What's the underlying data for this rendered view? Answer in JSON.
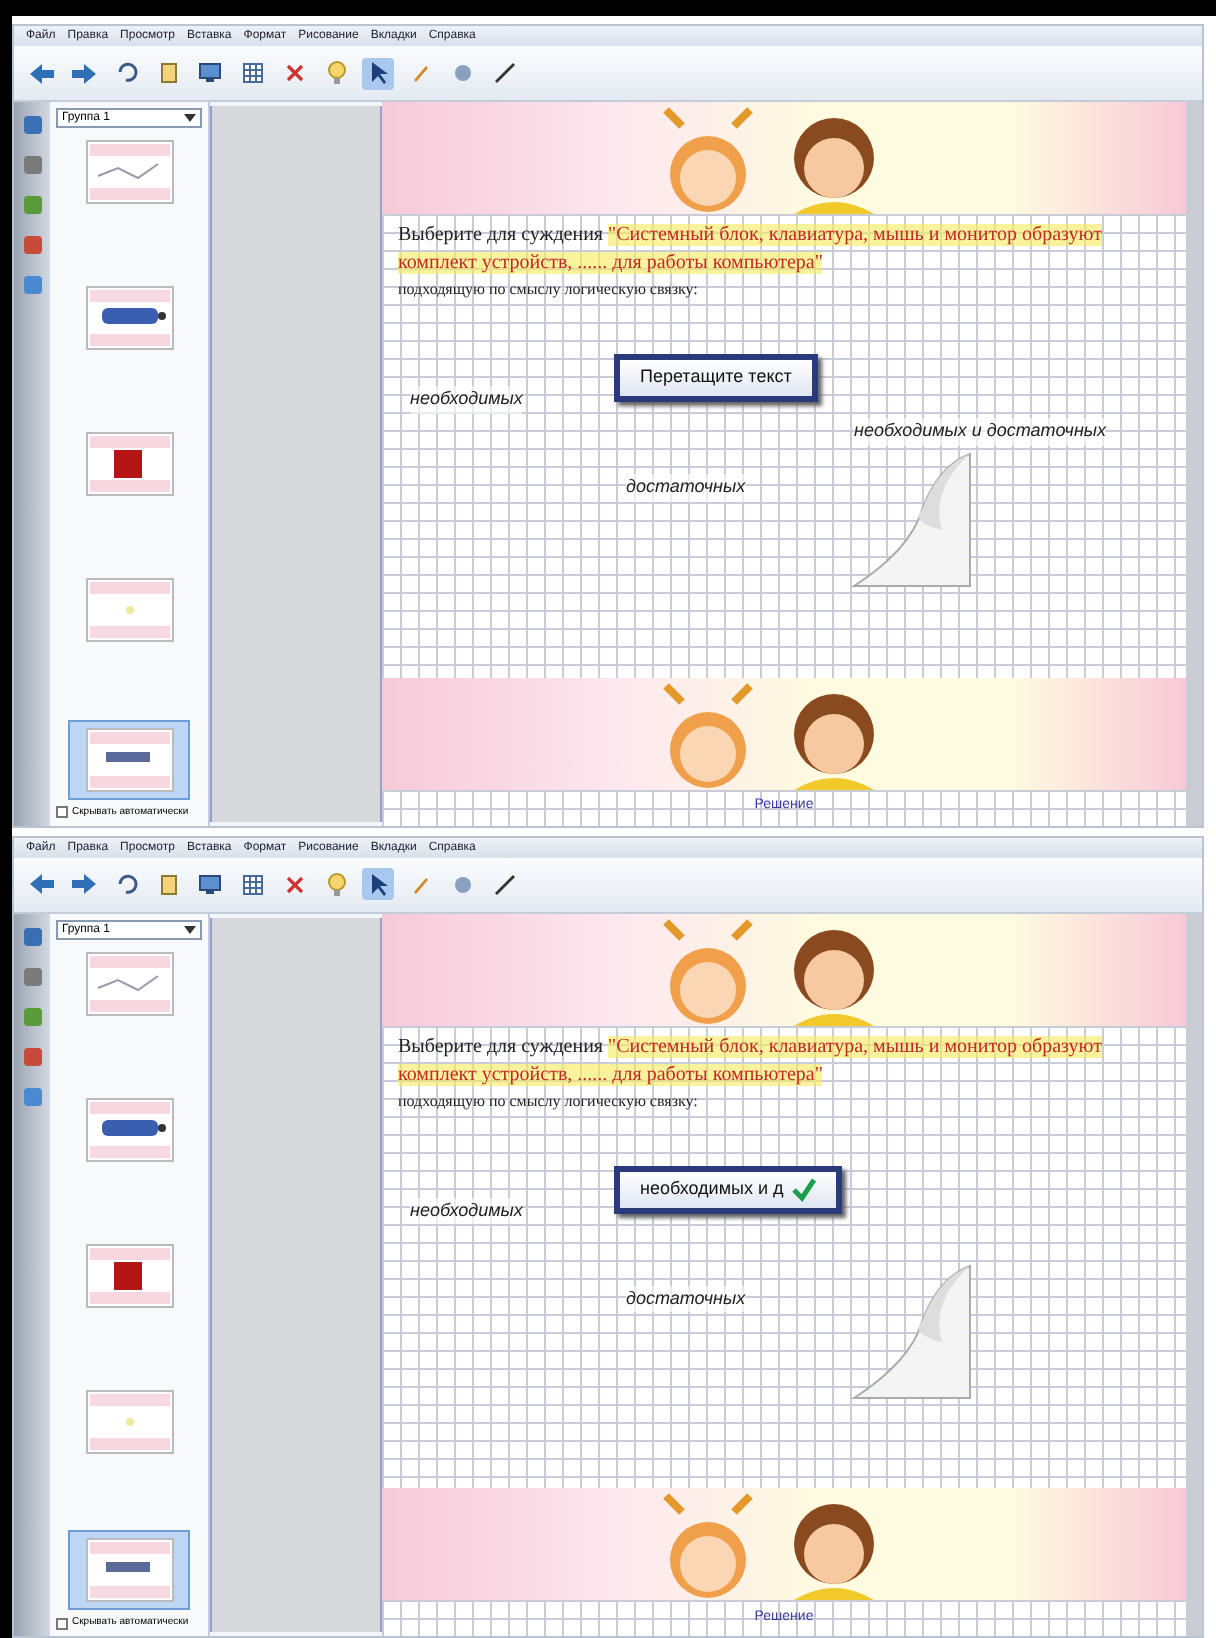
{
  "windows": [
    {
      "menu": [
        "Файл",
        "Правка",
        "Просмотр",
        "Вставка",
        "Формат",
        "Рисование",
        "Вкладки",
        "Справка"
      ],
      "sorter": {
        "group": "Группа 1",
        "thumbnails": [
          {
            "selected": false,
            "kind": "chart"
          },
          {
            "selected": false,
            "kind": "buttons"
          },
          {
            "selected": false,
            "kind": "red"
          },
          {
            "selected": false,
            "kind": "plain"
          },
          {
            "selected": true,
            "kind": "task"
          }
        ],
        "autohide": {
          "label": "Скрывать автоматически",
          "checked": false
        }
      },
      "page": {
        "prompt": "Выберите для суждения ",
        "quote": "\"Системный блок, клавиатура, мышь и монитор образуют комплект устройств, ...... для работы компьютера\"",
        "prompt_tail": "подходящую по смыслу логическую связку:",
        "options": [
          {
            "kind": "label",
            "text": "необходимых"
          },
          {
            "kind": "box",
            "text": "Перетащите текст",
            "checked": false
          },
          {
            "kind": "label",
            "text": "необходимых и достаточных"
          },
          {
            "kind": "label",
            "text": "достаточных"
          }
        ],
        "footer": "Решение"
      }
    },
    {
      "menu": [
        "Файл",
        "Правка",
        "Просмотр",
        "Вставка",
        "Формат",
        "Рисование",
        "Вкладки",
        "Справка"
      ],
      "sorter": {
        "group": "Группа 1",
        "thumbnails": [
          {
            "selected": false,
            "kind": "chart"
          },
          {
            "selected": false,
            "kind": "buttons"
          },
          {
            "selected": false,
            "kind": "red"
          },
          {
            "selected": false,
            "kind": "plain"
          },
          {
            "selected": true,
            "kind": "task"
          }
        ],
        "autohide": {
          "label": "Скрывать автоматически",
          "checked": false
        }
      },
      "page": {
        "prompt": "Выберите для суждения ",
        "quote": "\"Системный блок, клавиатура, мышь и монитор образуют комплект устройств, ...... для работы компьютера\"",
        "prompt_tail": "подходящую по смыслу логическую связку:",
        "options": [
          {
            "kind": "label",
            "text": "необходимых"
          },
          {
            "kind": "box",
            "text": "необходимых и д",
            "checked": true
          },
          {
            "kind": "label",
            "text": "достаточных"
          }
        ],
        "footer": "Решение"
      }
    }
  ]
}
